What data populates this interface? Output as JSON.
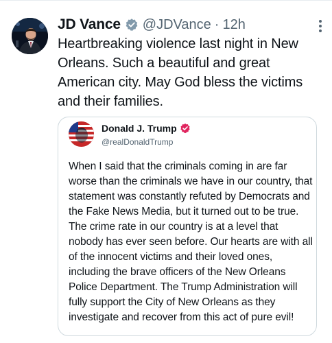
{
  "tweet": {
    "author_name": "JD Vance",
    "handle": "@JDVance",
    "separator": "·",
    "time": "12h",
    "text": "Heartbreaking violence last night in New Orleans. Such a beautiful and great American city. May God bless the victims and their families."
  },
  "quoted": {
    "author_name": "Donald J. Trump",
    "handle": "@realDonaldTrump",
    "text": "When I said that the criminals coming in are far worse than the criminals we have in our country, that statement was constantly refuted by Democrats and the Fake News Media, but it turned out to be true. The crime rate in our country is at a level that nobody has ever seen before. Our hearts are with all of the innocent victims and their loved ones, including the brave officers of the New Orleans Police Department. The Trump Administration will fully support the City of New Orleans as they investigate and recover from this act of pure evil!"
  },
  "icons": {
    "verified_main": "verified-badge-gray",
    "verified_quoted": "verified-badge-red",
    "more": "more-vertical-icon"
  },
  "colors": {
    "text_primary": "#0f1419",
    "text_secondary": "#536471",
    "border": "#cfd9de",
    "verified_gray": "#829aab",
    "verified_red": "#e0245e"
  }
}
